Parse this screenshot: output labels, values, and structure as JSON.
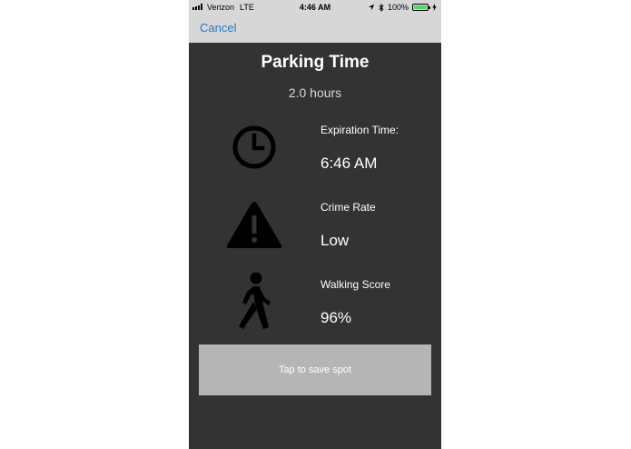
{
  "status_bar": {
    "carrier": "Verizon",
    "network": "LTE",
    "time": "4:46 AM",
    "battery_percent": "100%",
    "battery_level": 1.0
  },
  "nav": {
    "cancel_label": "Cancel"
  },
  "header": {
    "title": "Parking Time",
    "duration": "2.0 hours"
  },
  "info_rows": [
    {
      "icon": "clock-icon",
      "label": "Expiration Time:",
      "value": "6:46 AM"
    },
    {
      "icon": "warning-triangle-icon",
      "label": "Crime Rate",
      "value": "Low"
    },
    {
      "icon": "walking-person-icon",
      "label": "Walking Score",
      "value": "96%"
    }
  ],
  "actions": {
    "save_label": "Tap to save spot"
  },
  "colors": {
    "panel_background": "#333333",
    "nav_background": "#d7d7d7",
    "link_blue": "#2a76c6",
    "button_gray": "#b5b5b5",
    "battery_green": "#4cd964"
  }
}
